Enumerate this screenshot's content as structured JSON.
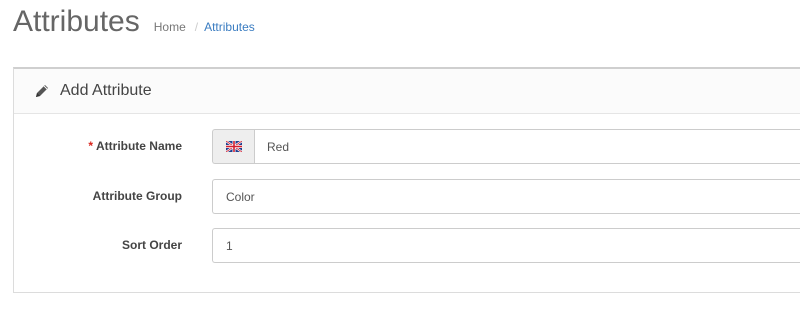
{
  "header": {
    "title": "Attributes",
    "breadcrumb": {
      "home": "Home",
      "separator": "/",
      "current": "Attributes"
    }
  },
  "panel": {
    "title": "Add Attribute",
    "icon": "pencil-icon"
  },
  "form": {
    "required_marker": "*",
    "attribute_name": {
      "label": "Attribute Name",
      "value": "Red",
      "language_icon": "uk-flag-icon"
    },
    "attribute_group": {
      "label": "Attribute Group",
      "value": "Color"
    },
    "sort_order": {
      "label": "Sort Order",
      "value": "1"
    }
  },
  "colors": {
    "link": "#3a7cc1",
    "required": "#d9251d",
    "title": "#666666"
  }
}
